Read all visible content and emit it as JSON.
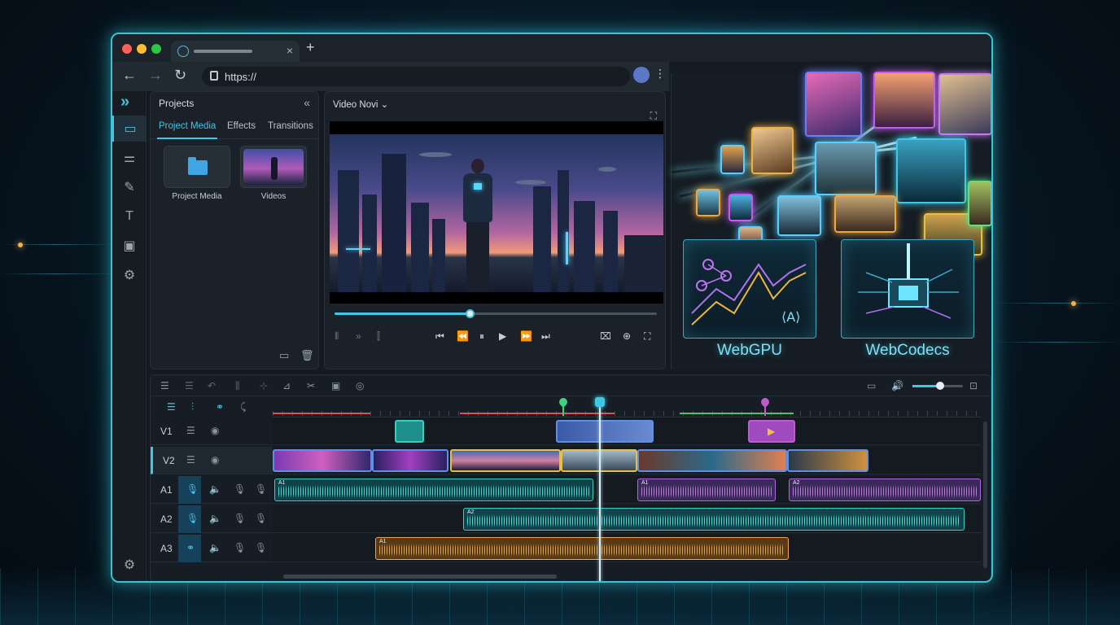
{
  "browser": {
    "url": "https://",
    "new_tab": "+",
    "tab_close": "×",
    "back": "←",
    "forward": "→",
    "reload": "↻",
    "menu": "⋮"
  },
  "projects_panel": {
    "title": "Projects",
    "collapse": "«",
    "tabs": [
      {
        "label": "Project Media",
        "active": true
      },
      {
        "label": "Effects",
        "active": false
      },
      {
        "label": "Transitions",
        "active": false
      }
    ],
    "items": [
      {
        "label": "Project Media",
        "icon": "folder-icon"
      },
      {
        "label": "Videos",
        "icon": "video-thumbnail"
      }
    ]
  },
  "preview": {
    "title": "Video Novi ⌄",
    "progress": 0.42
  },
  "showcase": {
    "tech": [
      {
        "label": "WebGPU"
      },
      {
        "label": "WebCodecs"
      }
    ]
  },
  "timeline": {
    "tracks": [
      {
        "name": "V1",
        "kind": "video"
      },
      {
        "name": "V2",
        "kind": "video",
        "selected": true
      },
      {
        "name": "A1",
        "kind": "audio"
      },
      {
        "name": "A2",
        "kind": "audio"
      },
      {
        "name": "A3",
        "kind": "audio"
      }
    ],
    "audio_clip_tags": [
      "A1",
      "A1",
      "A2",
      "A2",
      "A1"
    ],
    "zoom_level": 0.55
  },
  "colors": {
    "accent": "#3fc7e6",
    "clip_teal": "#2fd3c6",
    "clip_purple": "#b466e8",
    "clip_orange": "#f0a640",
    "clip_blue": "#5d8ee8",
    "clip_gold": "#e8c040"
  }
}
